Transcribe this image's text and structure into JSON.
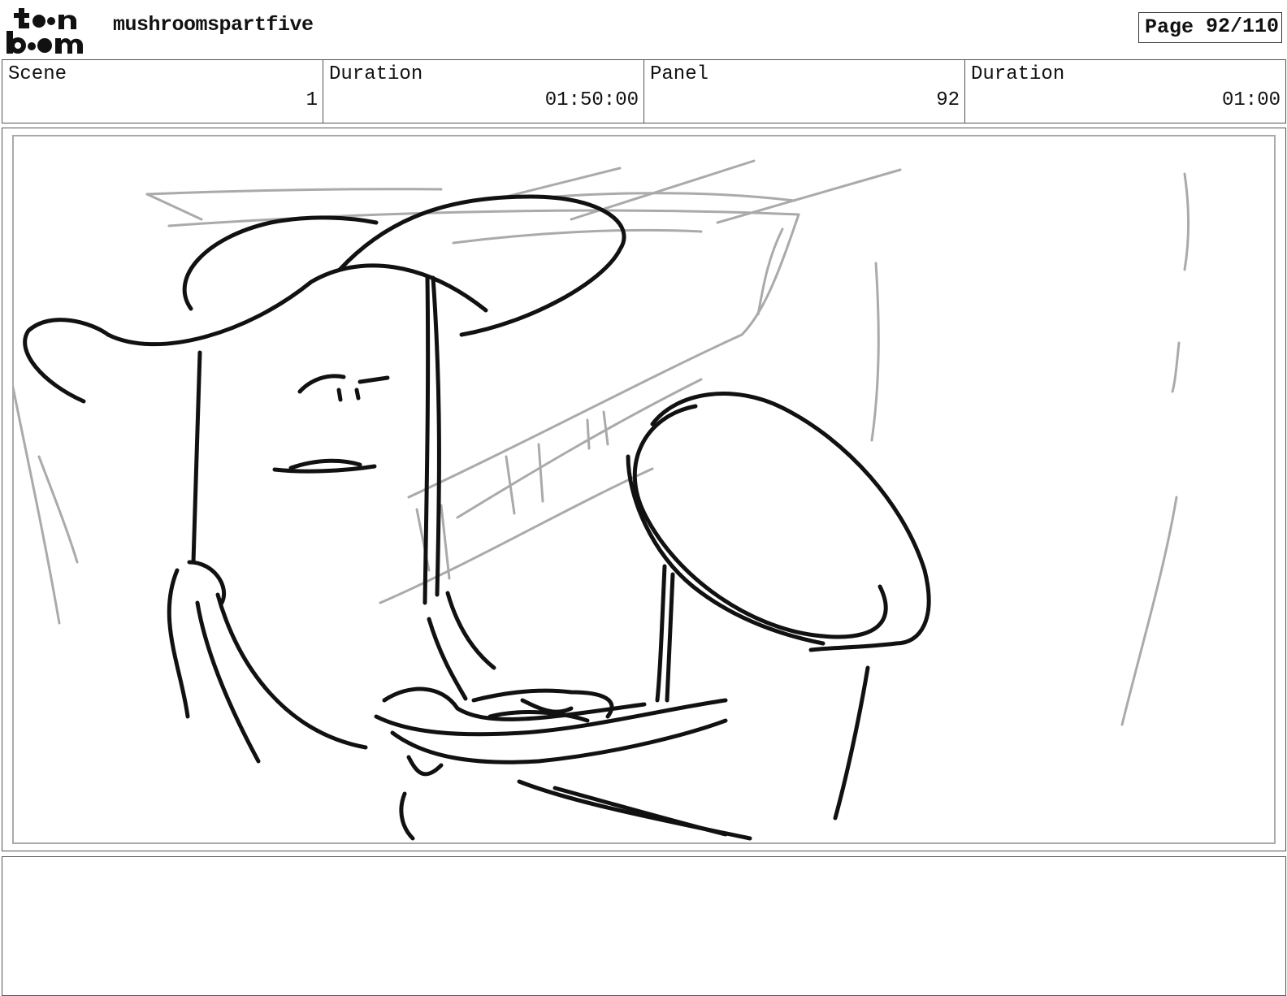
{
  "header": {
    "logo_text": "toon boom",
    "project_title": "mushroomspartfive",
    "page_label": "Page",
    "page_value": "92/110"
  },
  "info": {
    "scene": {
      "label": "Scene",
      "value": "1"
    },
    "scene_duration": {
      "label": "Duration",
      "value": "01:50:00"
    },
    "panel": {
      "label": "Panel",
      "value": "92"
    },
    "panel_duration": {
      "label": "Duration",
      "value": "01:00"
    }
  },
  "panel_image": {
    "icon": "storyboard-sketch-drawing"
  },
  "notes": {
    "text": ""
  }
}
